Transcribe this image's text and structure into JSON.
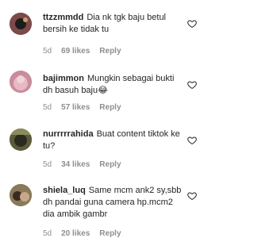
{
  "comments": [
    {
      "username": "ttzzmmdd",
      "text": "Dia nk tgk baju betul bersih ke tidak tu",
      "age": "5d",
      "likes": "69 likes",
      "reply": "Reply",
      "avatar_bg": "#7d4a4a"
    },
    {
      "username": "bajimmon",
      "text": "Mungkin sebagai bukti dh basuh baju😂",
      "age": "5d",
      "likes": "57 likes",
      "reply": "Reply",
      "avatar_bg": "#c98c9c"
    },
    {
      "username": "nurrrrrahida",
      "text": "Buat content tiktok ke tu?",
      "age": "5d",
      "likes": "34 likes",
      "reply": "Reply",
      "avatar_bg": "#6b6a45"
    },
    {
      "username": "shiela_luq",
      "text": "Same mcm ank2 sy,sbb dh pandai guna camera hp.mcm2 dia ambik gambr",
      "age": "5d",
      "likes": "20 likes",
      "reply": "Reply",
      "avatar_bg": "#8a6a52"
    }
  ],
  "colors": {
    "text": "#262626",
    "meta": "#8e8e8e",
    "background": "#ffffff"
  },
  "icons": {
    "like": "heart-outline-icon"
  }
}
